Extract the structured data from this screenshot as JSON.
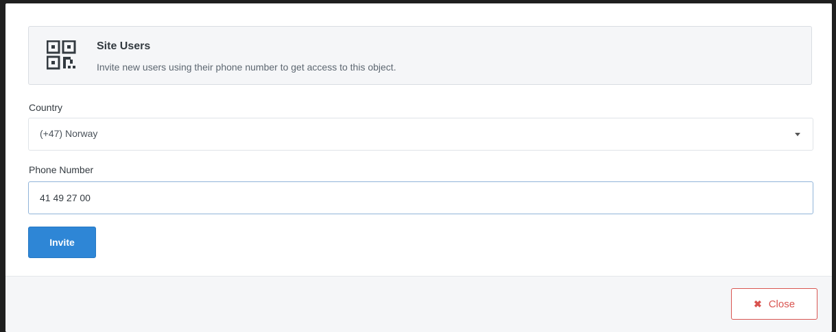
{
  "info": {
    "icon": "qr-code-icon",
    "title": "Site Users",
    "description": "Invite new users using their phone number to get access to this object."
  },
  "country": {
    "label": "Country",
    "selected": "(+47) Norway"
  },
  "phone": {
    "label": "Phone Number",
    "value": "41 49 27 00"
  },
  "actions": {
    "invite_label": "Invite",
    "close_label": "Close",
    "close_icon": "times-icon"
  },
  "colors": {
    "primary": "#2e86d6",
    "danger": "#d9534f"
  }
}
